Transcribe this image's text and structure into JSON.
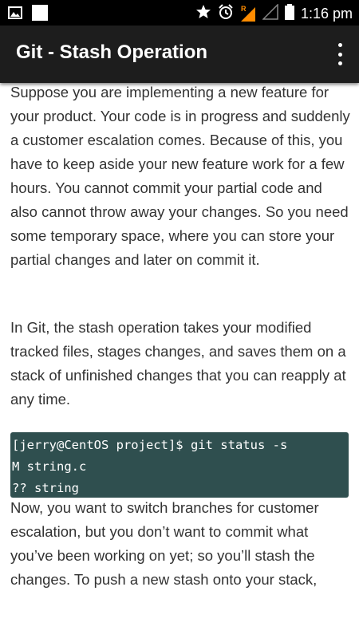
{
  "status_bar": {
    "time": "1:16 pm",
    "network_badge": "R",
    "icons": [
      "image-icon",
      "square-icon",
      "star-icon",
      "alarm-icon",
      "signal-icon",
      "signal-empty-icon",
      "battery-icon"
    ]
  },
  "app_bar": {
    "title": "Git - Stash Operation",
    "menu_icon": "more-vert-icon"
  },
  "content": {
    "paragraph1": "Suppose you are implementing a new feature for your product. Your code is in progress and suddenly a customer escalation comes. Because of this, you have to keep aside your new feature work for a few hours. You cannot commit your partial code and also cannot throw away your changes. So you need some temporary space, where you can store your partial changes and later on commit it.",
    "paragraph2": "In Git, the stash operation takes your modified tracked files, stages changes, and saves them on a stack of unfinished changes that you can reapply at any time.",
    "code_lines": [
      "[jerry@CentOS project]$ git status -s",
      "M string.c",
      "?? string"
    ],
    "paragraph3": "Now, you want to switch branches for customer escalation, but you don’t want to commit what you’ve been working on yet; so you’ll stash the changes. To push a new stash onto your stack,"
  },
  "colors": {
    "status_bar_bg": "#000000",
    "app_bar_bg": "#1d1d1d",
    "code_bg": "#2f4f4f",
    "accent_orange": "#ff8c00"
  }
}
